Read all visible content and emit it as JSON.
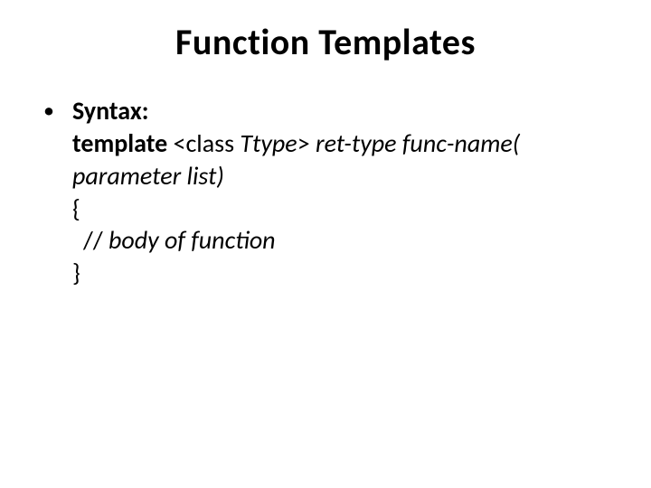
{
  "title": "Function Templates",
  "bullet_glyph": "•",
  "syntax_label": "Syntax:",
  "line1_bold": "template",
  "line1_rest": " <class ",
  "line1_ttype": "Ttype",
  "line1_after_ttype": "> ",
  "line1_italic_tail": "ret-type func-name(",
  "line2_italic": "parameter list)",
  "line3": "{",
  "line4_prefix": " // ",
  "line4_italic": "body of function",
  "line5": "}"
}
